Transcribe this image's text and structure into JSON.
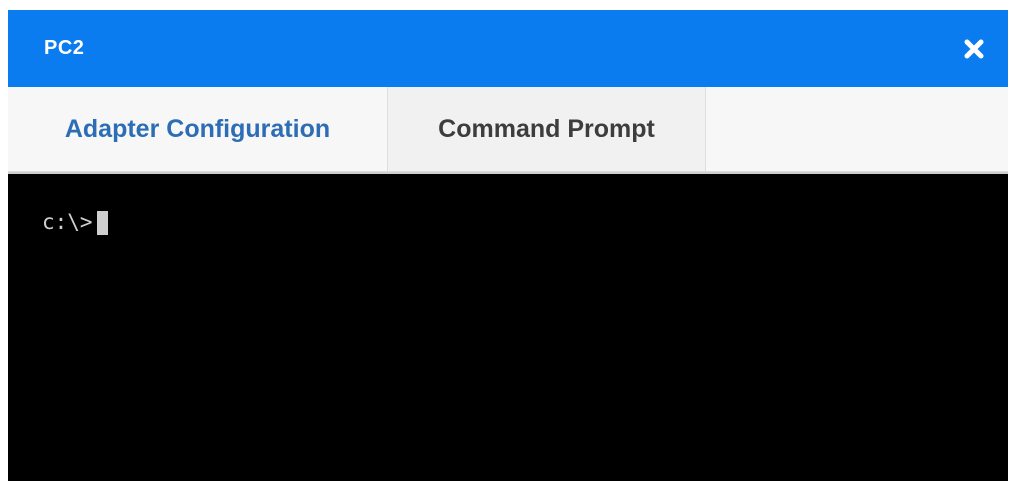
{
  "window": {
    "title": "PC2",
    "close_icon": "close-icon"
  },
  "tabs": [
    {
      "label": "Adapter Configuration",
      "active": true
    },
    {
      "label": "Command Prompt",
      "active": false
    }
  ],
  "terminal": {
    "prompt": "c:\\>"
  },
  "colors": {
    "titlebar": "#0a7cf0",
    "active_tab_text": "#2d6db5",
    "terminal_bg": "#000000",
    "terminal_text": "#cfcfcf"
  }
}
